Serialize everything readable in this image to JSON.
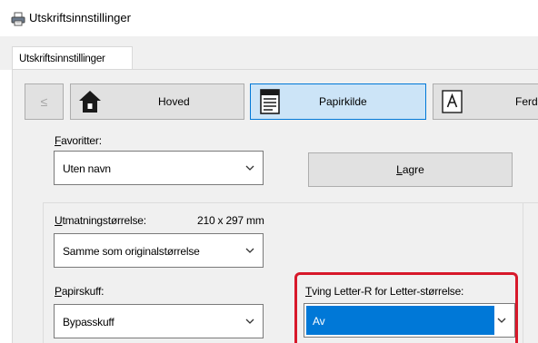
{
  "window": {
    "title": "Utskriftsinnstillinger",
    "title_icon": "printer-icon"
  },
  "tabs": [
    {
      "label": "Utskriftsinnstillinger",
      "selected": true
    }
  ],
  "nav": {
    "prev_label": "≤",
    "items": [
      {
        "label": "Hoved",
        "icon": "home-icon",
        "selected": false
      },
      {
        "label": "Papirkilde",
        "icon": "paper-tray-icon",
        "selected": true
      },
      {
        "label": "Ferdig",
        "icon": "finishing-icon",
        "selected": false
      }
    ]
  },
  "favorites": {
    "label_hot": "F",
    "label_rest": "avoritter:",
    "value": "Uten navn",
    "save_hot": "L",
    "save_rest": "agre"
  },
  "output_size": {
    "label_hot": "U",
    "label_rest": "tmatningstørrelse:",
    "dimensions": "210 x 297 mm",
    "value": "Samme som originalstørrelse"
  },
  "paper_tray": {
    "label_hot": "P",
    "label_rest": "apirskuff:",
    "value": "Bypasskuff"
  },
  "force_letter": {
    "label_hot": "T",
    "label_rest": "ving Letter-R for Letter-størrelse:",
    "value": "Av"
  },
  "colors": {
    "accent": "#0078d7",
    "highlight": "#d7182a",
    "selected_nav": "#cce4f7"
  }
}
